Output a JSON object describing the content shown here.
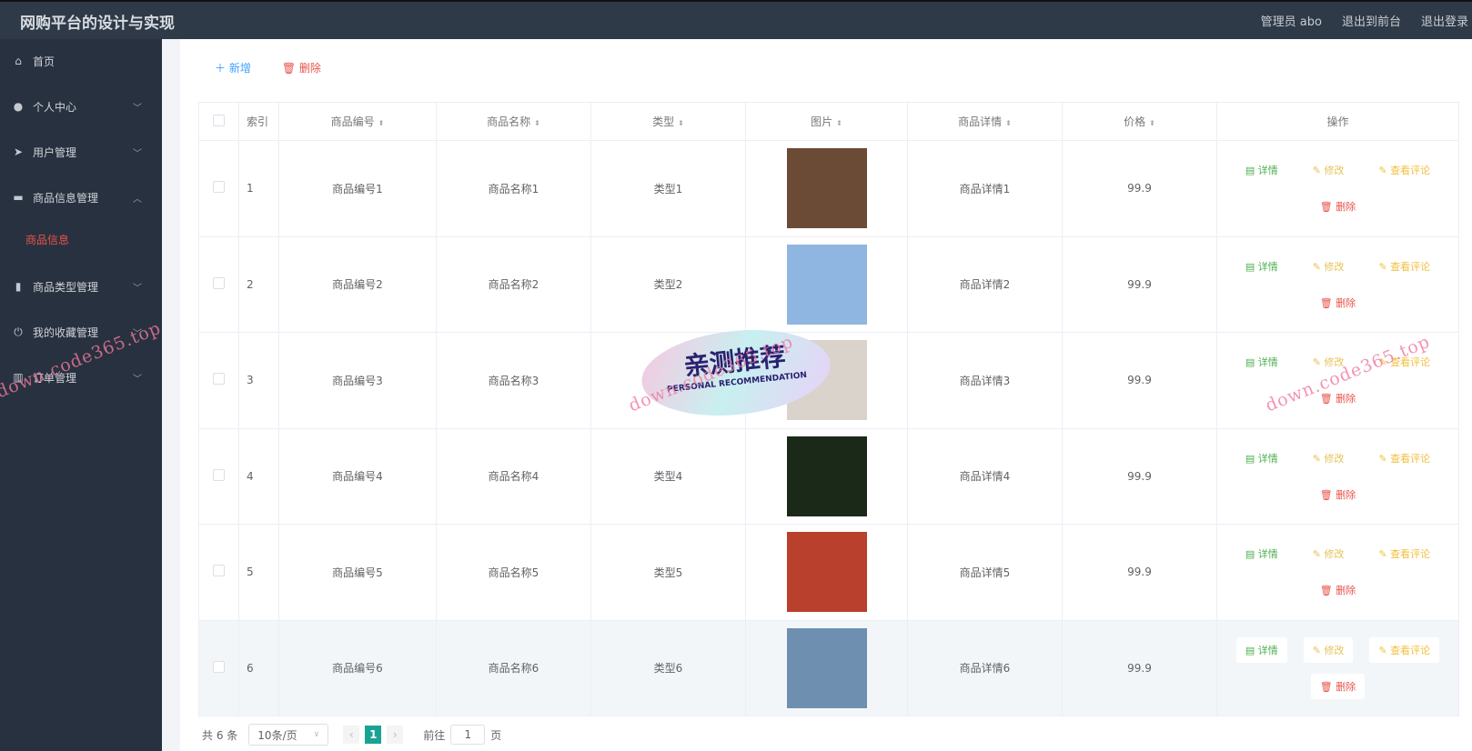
{
  "header": {
    "title": "网购平台的设计与实现",
    "user": "管理员 abo",
    "to_front": "退出到前台",
    "logout": "退出登录"
  },
  "sidebar": {
    "items": [
      {
        "label": "首页",
        "icon": "home-icon",
        "chev": ""
      },
      {
        "label": "个人中心",
        "icon": "user-icon",
        "chev": "﹀"
      },
      {
        "label": "用户管理",
        "icon": "send-icon",
        "chev": "﹀"
      },
      {
        "label": "商品信息管理",
        "icon": "briefcase-icon",
        "chev": "︿"
      },
      {
        "label": "商品类型管理",
        "icon": "clipboard-icon",
        "chev": "﹀"
      },
      {
        "label": "我的收藏管理",
        "icon": "power-icon",
        "chev": "﹀"
      },
      {
        "label": "订单管理",
        "icon": "chart-icon",
        "chev": "﹀"
      }
    ],
    "sub_item": "商品信息"
  },
  "toolbar": {
    "add": "新增",
    "delete": "删除"
  },
  "table": {
    "headers": [
      "索引",
      "商品编号",
      "商品名称",
      "类型",
      "图片",
      "商品详情",
      "价格",
      "操作"
    ],
    "rows": [
      {
        "index": "1",
        "code": "商品编号1",
        "name": "商品名称1",
        "type": "类型1",
        "detail": "商品详情1",
        "price": "99.9",
        "img": "#6b4a36"
      },
      {
        "index": "2",
        "code": "商品编号2",
        "name": "商品名称2",
        "type": "类型2",
        "detail": "商品详情2",
        "price": "99.9",
        "img": "#8fb6e0"
      },
      {
        "index": "3",
        "code": "商品编号3",
        "name": "商品名称3",
        "type": "类型3",
        "detail": "商品详情3",
        "price": "99.9",
        "img": "#d9d3cc"
      },
      {
        "index": "4",
        "code": "商品编号4",
        "name": "商品名称4",
        "type": "类型4",
        "detail": "商品详情4",
        "price": "99.9",
        "img": "#1b2a18"
      },
      {
        "index": "5",
        "code": "商品编号5",
        "name": "商品名称5",
        "type": "类型5",
        "detail": "商品详情5",
        "price": "99.9",
        "img": "#b8402c"
      },
      {
        "index": "6",
        "code": "商品编号6",
        "name": "商品名称6",
        "type": "类型6",
        "detail": "商品详情6",
        "price": "99.9",
        "img": "#6e8fb0"
      }
    ],
    "actions": {
      "detail": "详情",
      "edit": "修改",
      "comments": "查看评论",
      "delete": "删除"
    }
  },
  "pagination": {
    "total": "共 6 条",
    "page_size": "10条/页",
    "current": "1",
    "goto": "前往",
    "goto_value": "1",
    "page_suffix": "页"
  },
  "watermark": {
    "text": "down.code365.top",
    "badge_cn": "亲测推荐",
    "badge_en": "PERSONAL RECOMMENDATION"
  }
}
